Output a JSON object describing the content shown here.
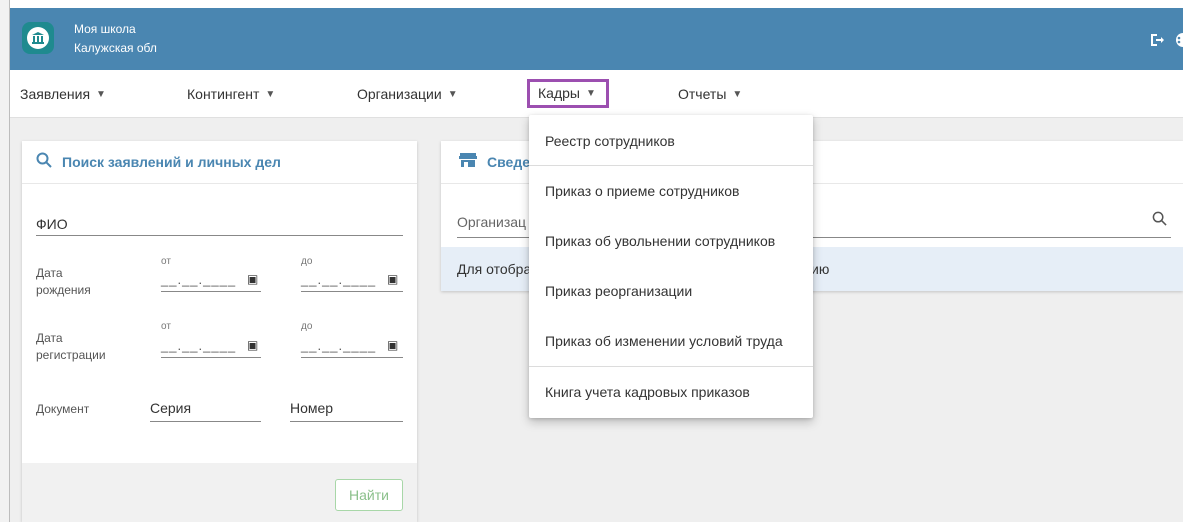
{
  "header": {
    "school_name": "Моя школа",
    "region": "Калужская обл"
  },
  "nav": {
    "items": [
      {
        "label": "Заявления"
      },
      {
        "label": "Контингент"
      },
      {
        "label": "Организации"
      },
      {
        "label": "Кадры",
        "active": true
      },
      {
        "label": "Отчеты"
      }
    ]
  },
  "search_panel": {
    "title": "Поиск заявлений и личных дел",
    "fio_label": "ФИО",
    "birth_label_1": "Дата",
    "birth_label_2": "рождения",
    "reg_label_1": "Дата",
    "reg_label_2": "регистрации",
    "from_label": "от",
    "to_label": "до",
    "date_placeholder": "__.__.____",
    "document_label": "Документ",
    "series_label": "Серия",
    "number_label": "Номер",
    "find_button": "Найти"
  },
  "info_panel": {
    "title": "Сведе",
    "org_label": "Организац",
    "info_text_left": "Для отобра",
    "info_text_right": "ию"
  },
  "kadry_menu": {
    "items": [
      "Реестр сотрудников",
      "Приказ о приеме сотрудников",
      "Приказ об увольнении сотрудников",
      "Приказ реорганизации",
      "Приказ об изменении условий труда",
      "Книга учета кадровых приказов"
    ]
  },
  "colors": {
    "appbar": "#4a86b1",
    "logo": "#1f8a8f",
    "active_outline": "#9c4fb0",
    "title_blue": "#4a86b1",
    "find_button_border": "#a8d7a8"
  }
}
